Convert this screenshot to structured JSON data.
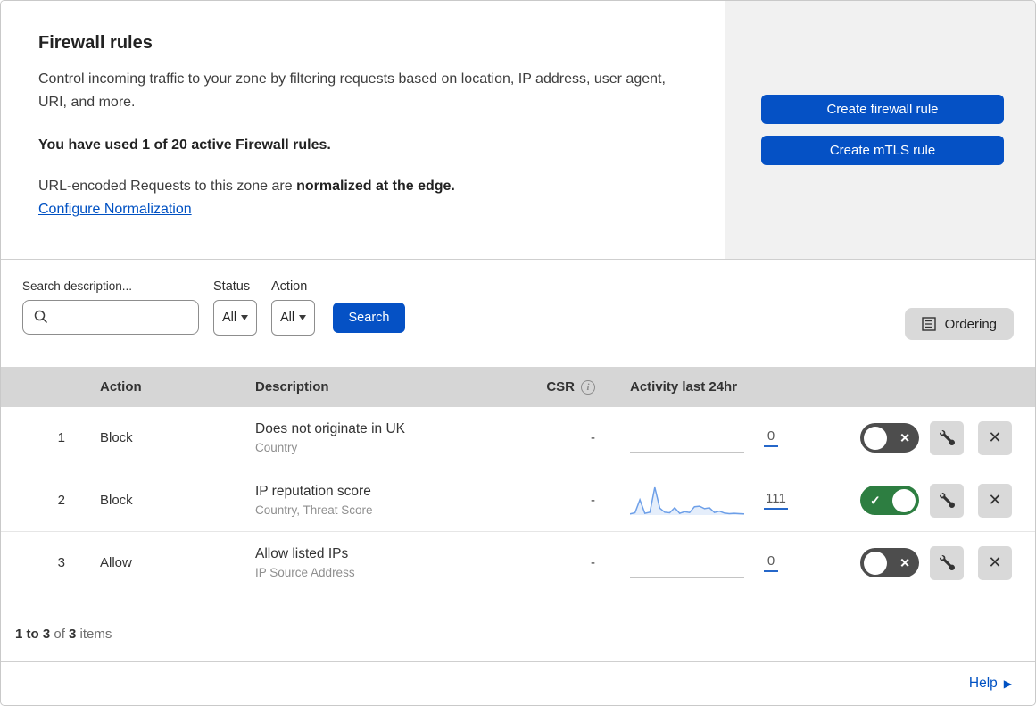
{
  "header": {
    "title": "Firewall rules",
    "description": "Control incoming traffic to your zone by filtering requests based on location, IP address, user agent, URI, and more.",
    "usage_notice": "You have used 1 of 20 active Firewall rules.",
    "normalization_text": "URL-encoded Requests to this zone are ",
    "normalization_bold": "normalized at the edge.",
    "normalization_link": "Configure Normalization"
  },
  "actions": {
    "create_firewall_rule": "Create firewall rule",
    "create_mtls_rule": "Create mTLS rule"
  },
  "filters": {
    "search_label": "Search description...",
    "status_label": "Status",
    "status_value": "All",
    "action_label": "Action",
    "action_value": "All",
    "search_button": "Search",
    "ordering_button": "Ordering"
  },
  "table": {
    "columns": {
      "action": "Action",
      "description": "Description",
      "csr": "CSR",
      "activity": "Activity last 24hr"
    },
    "rows": [
      {
        "priority": "1",
        "action": "Block",
        "description": "Does not originate in UK",
        "fields": "Country",
        "csr": "-",
        "activity_count": "0",
        "enabled": false,
        "sparkline": [
          0,
          0,
          0,
          0,
          0,
          0,
          0,
          0,
          0,
          0,
          0,
          0,
          0,
          0,
          0,
          0,
          0,
          0,
          0,
          0,
          0,
          0,
          0,
          0
        ]
      },
      {
        "priority": "2",
        "action": "Block",
        "description": "IP reputation score",
        "fields": "Country, Threat Score",
        "csr": "-",
        "activity_count": "111",
        "enabled": true,
        "sparkline": [
          4,
          8,
          55,
          6,
          10,
          100,
          25,
          10,
          8,
          26,
          6,
          12,
          9,
          30,
          32,
          23,
          26,
          9,
          14,
          7,
          5,
          6,
          5,
          4
        ]
      },
      {
        "priority": "3",
        "action": "Allow",
        "description": "Allow listed IPs",
        "fields": "IP Source Address",
        "csr": "-",
        "activity_count": "0",
        "enabled": false,
        "sparkline": [
          0,
          0,
          0,
          0,
          0,
          0,
          0,
          0,
          0,
          0,
          0,
          0,
          0,
          0,
          0,
          0,
          0,
          0,
          0,
          0,
          0,
          0,
          0,
          0
        ]
      }
    ]
  },
  "footer": {
    "range": "1 to 3",
    "of": " of ",
    "total": "3",
    "items": " items"
  },
  "help": {
    "label": "Help",
    "arrow": "▶"
  },
  "icons": {
    "info_glyph": "i",
    "check_glyph": "✓",
    "close_glyph": "✕"
  },
  "colors": {
    "primary_blue": "#0551c5",
    "link_blue": "#0051c3",
    "toggle_on_green": "#2d7e41",
    "toggle_off_gray": "#4d4d4d",
    "sparkline_stroke": "#6d9fe8",
    "sparkline_fill": "rgba(109,159,232,0.18)",
    "sparkline_flat": "#b0b0b0",
    "table_header_bg": "#d6d6d6",
    "panel_gray": "#f1f1f1"
  }
}
